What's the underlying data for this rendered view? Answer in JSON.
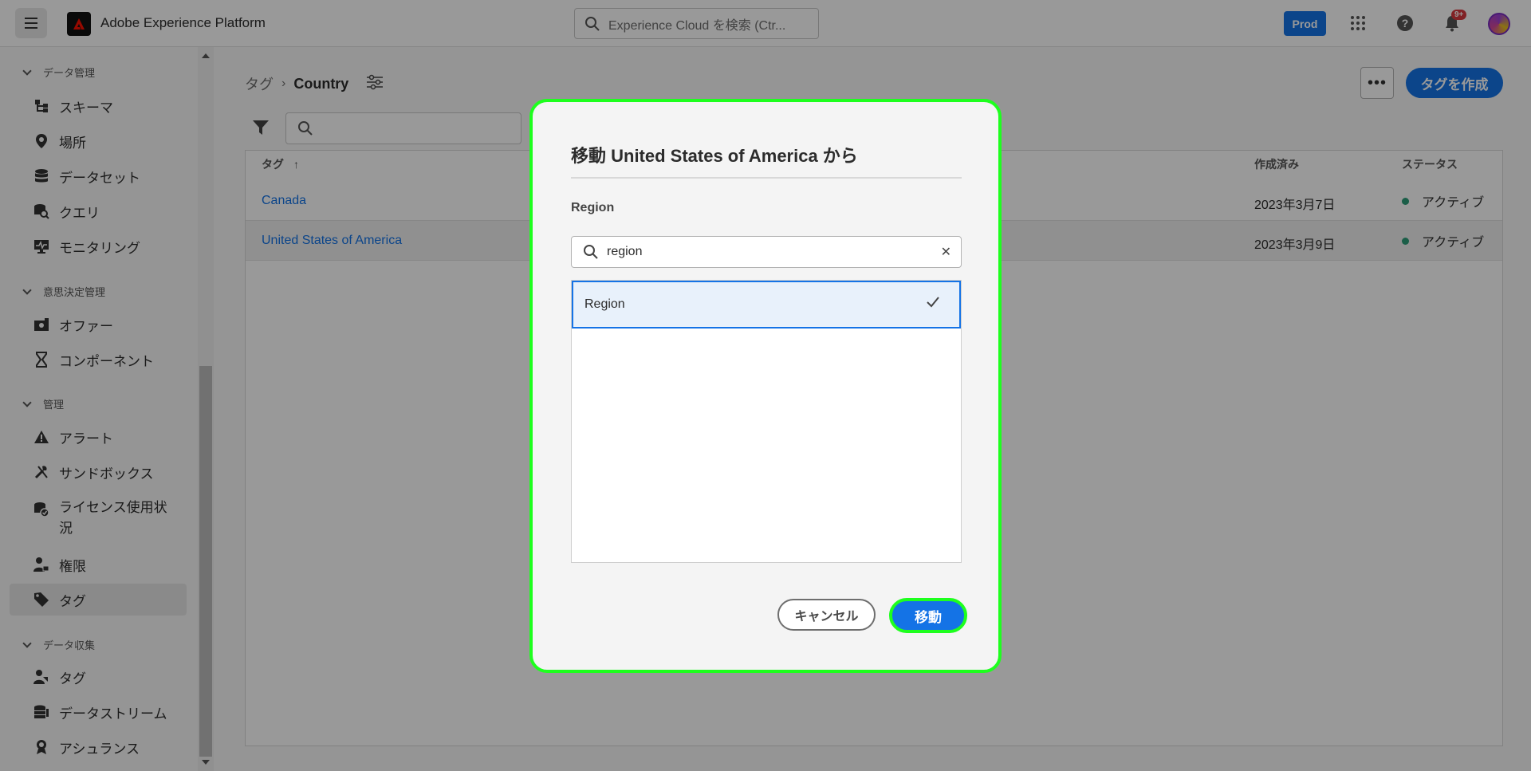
{
  "header": {
    "app_title": "Adobe Experience Platform",
    "search_placeholder": "Experience Cloud を検索 (Ctr...",
    "org": "Prod",
    "notification_count": "9+"
  },
  "sidebar": {
    "sections": [
      {
        "label": "データ管理",
        "items": [
          "スキーマ",
          "場所",
          "データセット",
          "クエリ",
          "モニタリング"
        ]
      },
      {
        "label": "意思決定管理",
        "items": [
          "オファー",
          "コンポーネント"
        ]
      },
      {
        "label": "管理",
        "items": [
          "アラート",
          "サンドボックス",
          "ライセンス使用状況",
          "権限",
          "タグ"
        ]
      },
      {
        "label": "データ収集",
        "items": [
          "タグ",
          "データストリーム",
          "アシュランス"
        ]
      }
    ],
    "active_item": "タグ"
  },
  "main": {
    "breadcrumb_root": "タグ",
    "breadcrumb_current": "Country",
    "create_button": "タグを作成",
    "columns": {
      "tag": "タグ",
      "created": "作成済み",
      "status": "ステータス"
    },
    "rows": [
      {
        "name": "Canada",
        "created": "2023年3月7日",
        "status": "アクティブ"
      },
      {
        "name": "United States of America",
        "created": "2023年3月9日",
        "status": "アクティブ"
      }
    ]
  },
  "dialog": {
    "title": "移動 United States of America から",
    "label": "Region",
    "search_value": "region",
    "options": [
      {
        "label": "Region",
        "selected": true
      }
    ],
    "cancel_label": "キャンセル",
    "move_label": "移動"
  },
  "colors": {
    "accent": "#1473e6",
    "highlight": "#1eff1e",
    "status_active": "#2d9d78"
  }
}
